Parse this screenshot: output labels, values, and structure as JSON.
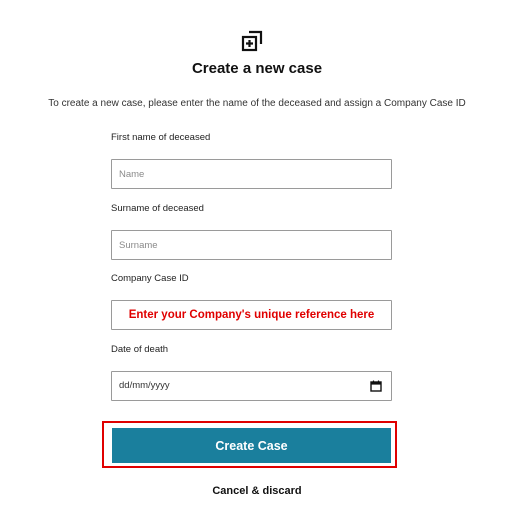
{
  "header": {
    "icon": "add-case-icon",
    "title": "Create a new case",
    "subtitle": "To create a new case, please enter the name of the deceased and assign a Company Case ID"
  },
  "form": {
    "first_name": {
      "label": "First name of deceased",
      "placeholder": "Name",
      "value": ""
    },
    "surname": {
      "label": "Surname of deceased",
      "placeholder": "Surname",
      "value": ""
    },
    "case_id": {
      "label": "Company Case ID",
      "value": "Enter your Company's unique reference here"
    },
    "date_of_death": {
      "label": "Date of death",
      "placeholder": "dd/mm/yyyy",
      "icon": "calendar-icon"
    }
  },
  "actions": {
    "create_label": "Create Case",
    "cancel_label": "Cancel & discard"
  },
  "colors": {
    "primary_button": "#1a7f9d",
    "highlight": "#e00000",
    "reference_text": "#e00000"
  }
}
